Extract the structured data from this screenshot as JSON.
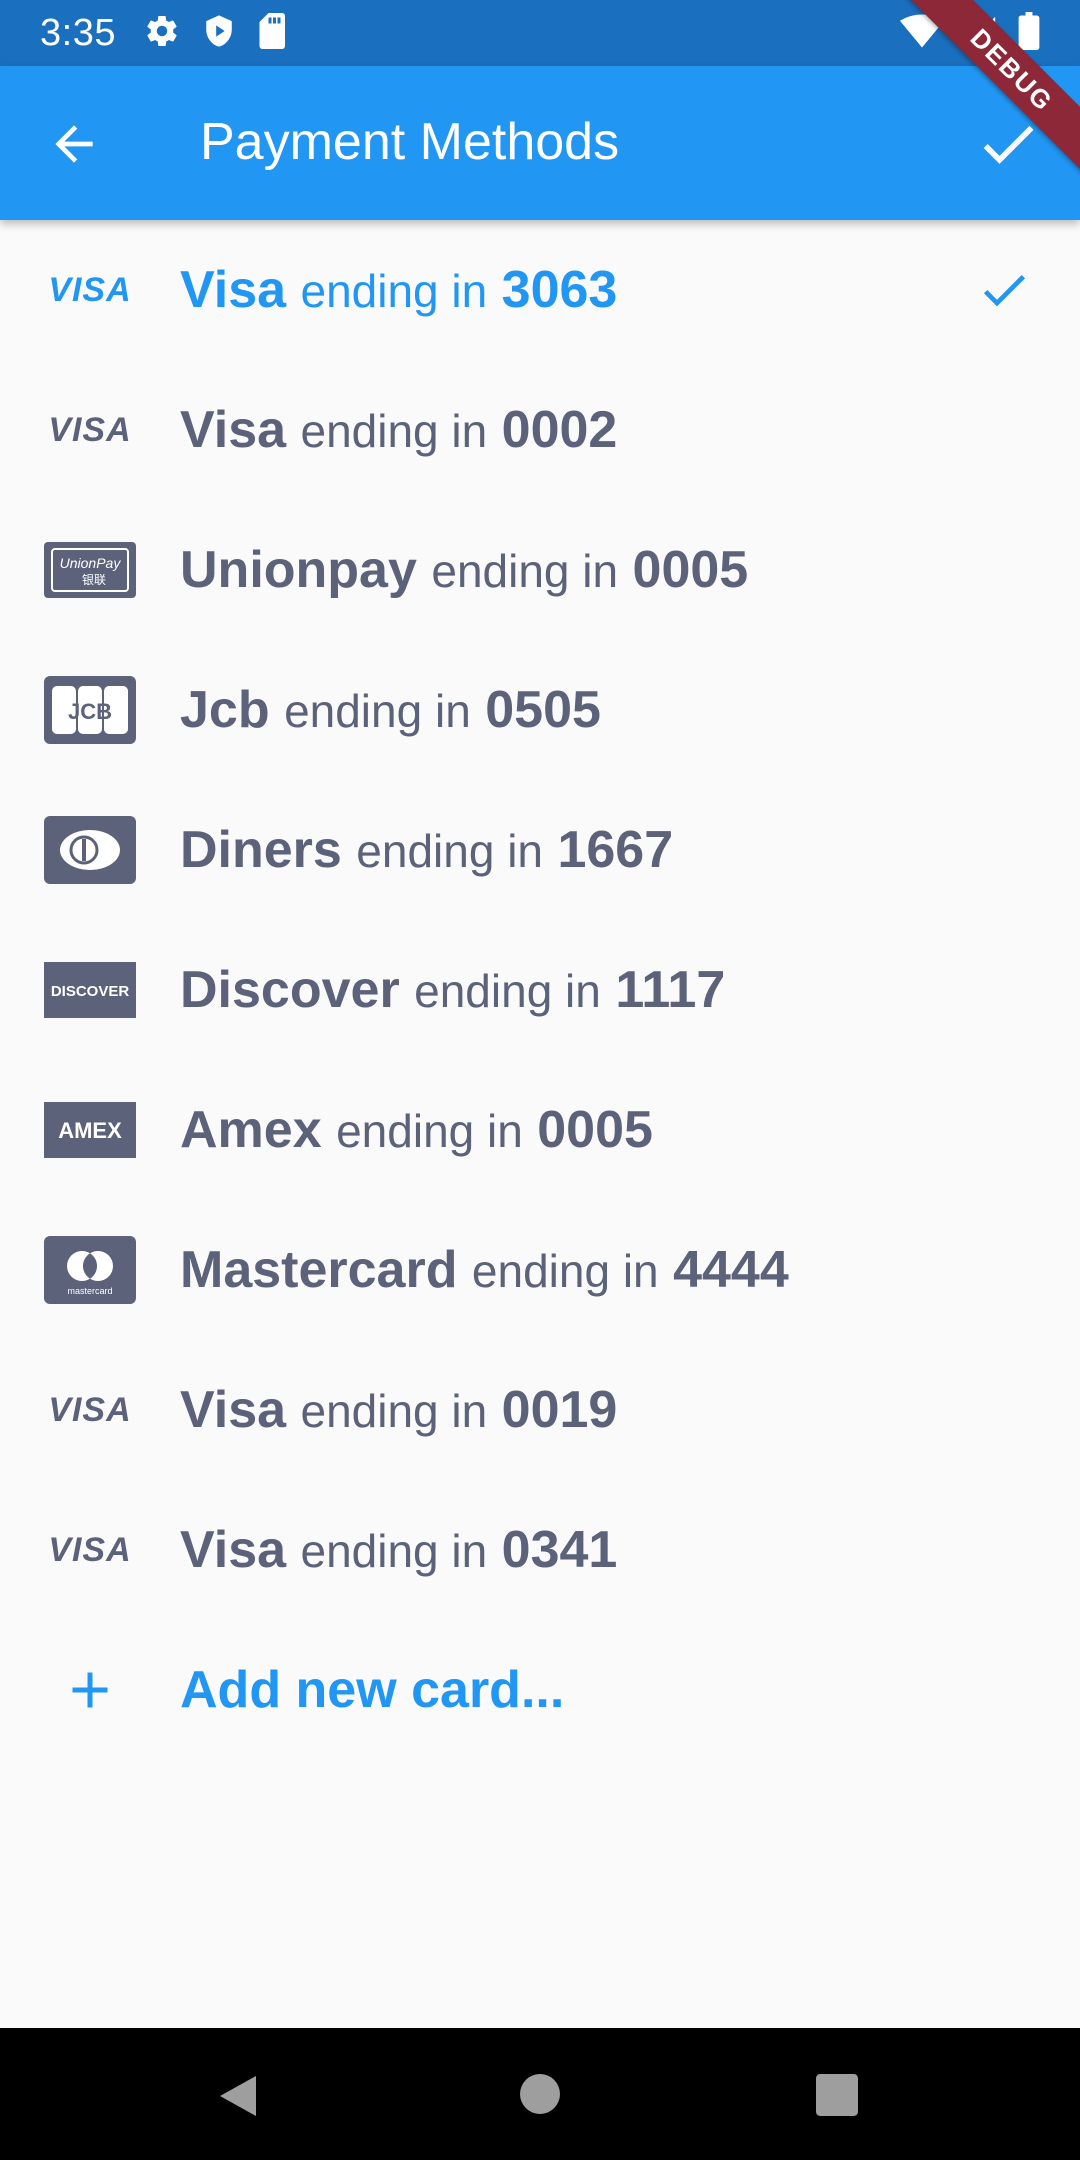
{
  "status_bar": {
    "time": "3:35",
    "left_icons": [
      "gear-icon",
      "shield-icon",
      "sd-card-icon"
    ],
    "right_icons": [
      "wifi-icon",
      "signal-icon",
      "battery-icon"
    ]
  },
  "debug_banner": "DEBUG",
  "app_bar": {
    "title": "Payment Methods",
    "back_icon": "arrow-back-icon",
    "done_icon": "check-icon"
  },
  "colors": {
    "primary": "#2196f3",
    "status_bar": "#1b6fbf",
    "text": "#5b6279",
    "background": "#fafafa",
    "debug": "#8d2838"
  },
  "cards": [
    {
      "brand": "Visa",
      "middle": "ending in",
      "last4": "3063",
      "logo": "VISA",
      "selected": true
    },
    {
      "brand": "Visa",
      "middle": "ending in",
      "last4": "0002",
      "logo": "VISA",
      "selected": false
    },
    {
      "brand": "Unionpay",
      "middle": "ending in",
      "last4": "0005",
      "logo": "UnionPay",
      "selected": false
    },
    {
      "brand": "Jcb",
      "middle": "ending in",
      "last4": "0505",
      "logo": "JCB",
      "selected": false
    },
    {
      "brand": "Diners",
      "middle": "ending in",
      "last4": "1667",
      "logo": "Diners",
      "selected": false
    },
    {
      "brand": "Discover",
      "middle": "ending in",
      "last4": "1117",
      "logo": "DISCOVER",
      "selected": false
    },
    {
      "brand": "Amex",
      "middle": "ending in",
      "last4": "0005",
      "logo": "AMEX",
      "selected": false
    },
    {
      "brand": "Mastercard",
      "middle": "ending in",
      "last4": "4444",
      "logo": "mastercard",
      "selected": false
    },
    {
      "brand": "Visa",
      "middle": "ending in",
      "last4": "0019",
      "logo": "VISA",
      "selected": false
    },
    {
      "brand": "Visa",
      "middle": "ending in",
      "last4": "0341",
      "logo": "VISA",
      "selected": false
    }
  ],
  "add_card": {
    "label": "Add new card...",
    "icon": "plus-icon"
  },
  "nav_bar": {
    "buttons": [
      "back-triangle-icon",
      "home-circle-icon",
      "recents-square-icon"
    ]
  }
}
